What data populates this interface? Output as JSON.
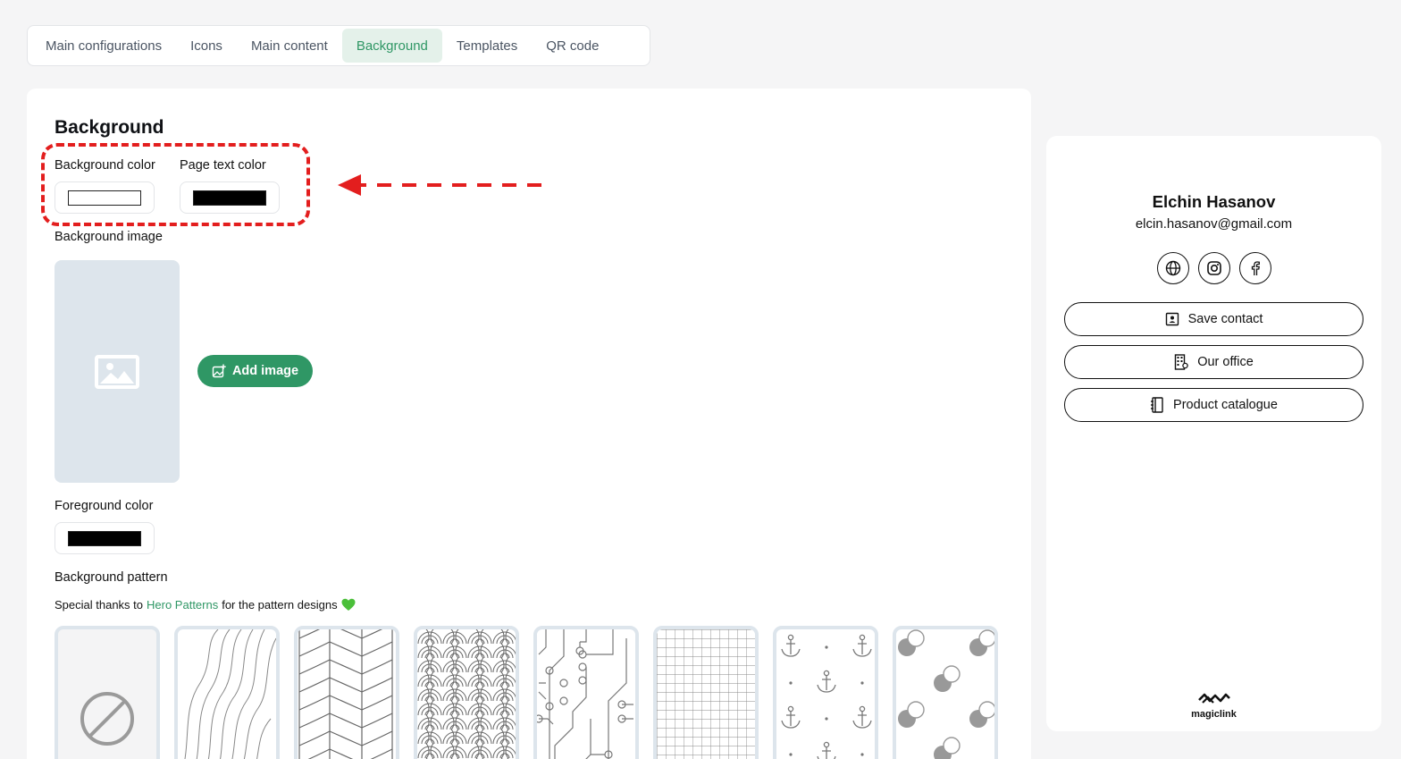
{
  "tabs": [
    {
      "label": "Main configurations"
    },
    {
      "label": "Icons"
    },
    {
      "label": "Main content"
    },
    {
      "label": "Background",
      "active": true
    },
    {
      "label": "Templates"
    },
    {
      "label": "QR code"
    }
  ],
  "section": {
    "title": "Background",
    "background_color_label": "Background color",
    "background_color_value": "#ffffff",
    "page_text_color_label": "Page text color",
    "page_text_color_value": "#000000",
    "background_image_label": "Background image",
    "add_image_label": "Add image",
    "foreground_color_label": "Foreground color",
    "foreground_color_value": "#000000",
    "background_pattern_label": "Background pattern",
    "thanks_prefix": "Special thanks to",
    "thanks_link": "Hero Patterns",
    "thanks_suffix": "for the pattern designs"
  },
  "patterns": [
    "none-icon",
    "topography",
    "herringbone",
    "waves",
    "circuit-board",
    "graph-paper",
    "anchors",
    "bubbles"
  ],
  "preview": {
    "name": "Elchin Hasanov",
    "email": "elcin.hasanov@gmail.com",
    "social_icons": [
      "globe-icon",
      "instagram-icon",
      "facebook-icon"
    ],
    "buttons": [
      {
        "label": "Save contact",
        "icon": "contact-card-icon"
      },
      {
        "label": "Our office",
        "icon": "building-icon"
      },
      {
        "label": "Product catalogue",
        "icon": "notebook-icon"
      }
    ],
    "brand": "magiclink"
  },
  "colors": {
    "accent": "#2f9765",
    "annotation": "#e31e1e"
  }
}
